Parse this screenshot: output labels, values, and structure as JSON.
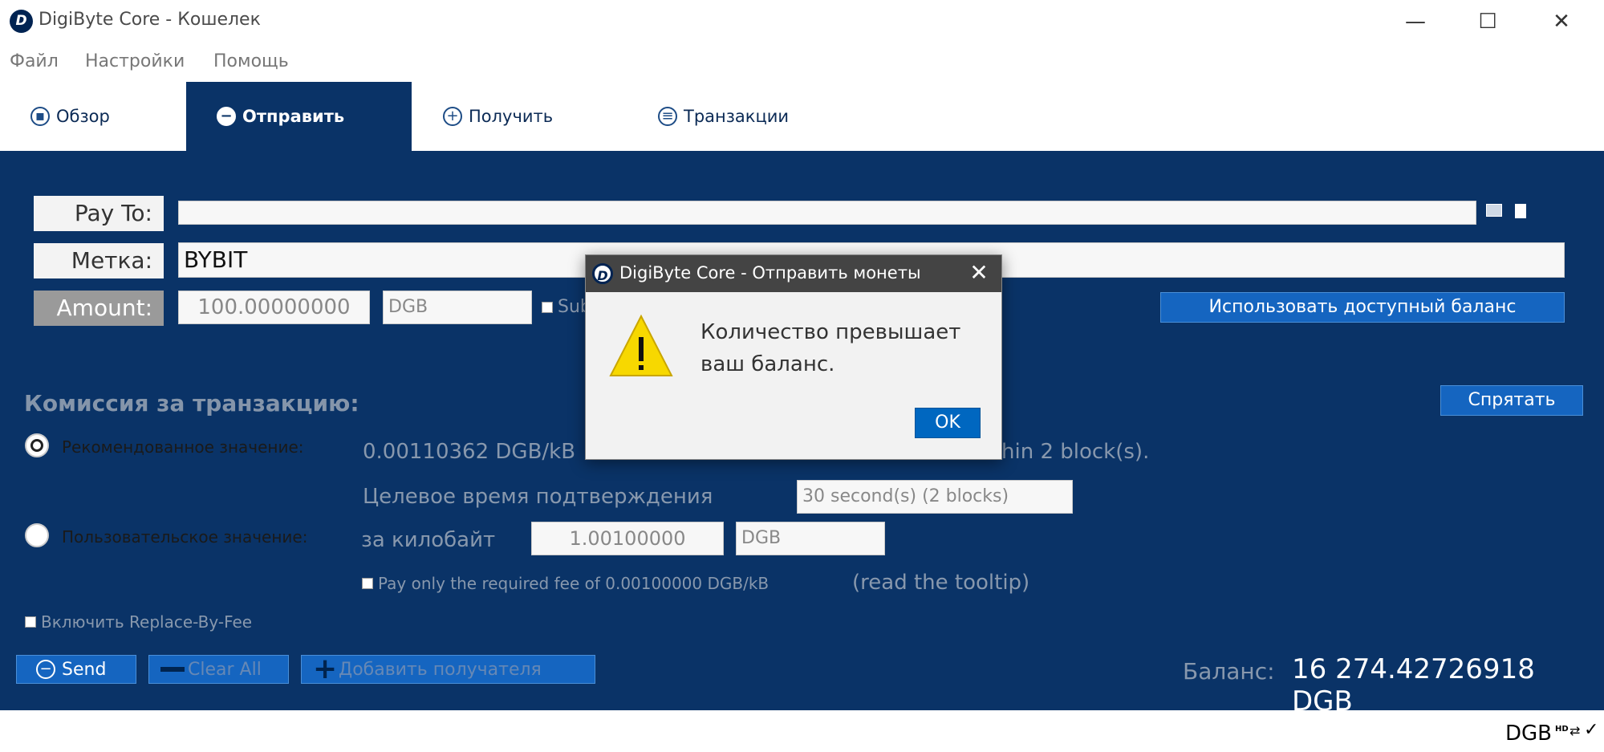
{
  "window": {
    "title": "DigiByte Core - Кошелек",
    "logo_letter": "D",
    "minimize_glyph": "—",
    "maximize_glyph": "☐",
    "close_glyph": "✕"
  },
  "menu": {
    "items": [
      "Файл",
      "Настройки",
      "Помощь"
    ]
  },
  "tabs": [
    {
      "label": "Обзор",
      "icon": "overview-icon",
      "active": false
    },
    {
      "label": "Отправить",
      "icon": "send-icon",
      "active": true
    },
    {
      "label": "Получить",
      "icon": "receive-icon",
      "active": false
    },
    {
      "label": "Транзакции",
      "icon": "transactions-icon",
      "active": false
    }
  ],
  "send_form": {
    "pay_to_label": "Pay To:",
    "pay_to_value": "",
    "label_label": "Метка:",
    "label_value": "BYBIT",
    "amount_label": "Amount:",
    "amount_value": "100.00000000",
    "amount_unit": "DGB",
    "subtract_fee_label": "Sub",
    "use_balance_button": "Использовать доступный баланс"
  },
  "fee": {
    "heading": "Комиссия за транзакцию:",
    "hide_button": "Спрятать",
    "recommended_label": "Рекомендованное значение:",
    "recommended_value": "0.00110362 DGB/kB",
    "recommended_suffix": "hin 2 block(s).",
    "target_time_label": "Целевое время подтверждения",
    "target_time_value": "30 second(s) (2 blocks)",
    "custom_label": "Пользовательское значение:",
    "per_kb_label": "за килобайт",
    "per_kb_value": "1.00100000",
    "per_kb_unit": "DGB",
    "pay_minimum_label": "Pay only the required fee of 0.00100000 DGB/kB",
    "tooltip_hint": "(read the tooltip)",
    "rbf_label": "Включить Replace-By-Fee"
  },
  "actions": {
    "send_label": "Send",
    "clear_all_label": "Clear All",
    "add_recipient_label": "Добавить получателя"
  },
  "balance": {
    "label": "Баланс:",
    "value": "16 274.42726918 DGB"
  },
  "statusbar": {
    "unit": "DGB",
    "hd_badge": "HD"
  },
  "dialog": {
    "title": "DigiByte Core - Отправить монеты",
    "message_line1": "Количество превышает",
    "message_line2": "ваш баланс.",
    "ok_label": "OK",
    "close_glyph": "✕",
    "warning_glyph": "!"
  },
  "colors": {
    "main_bg": "#0a3367",
    "accent_button": "#1565c0",
    "dialog_ok": "#0067c0",
    "warning_yellow": "#f7d800"
  }
}
